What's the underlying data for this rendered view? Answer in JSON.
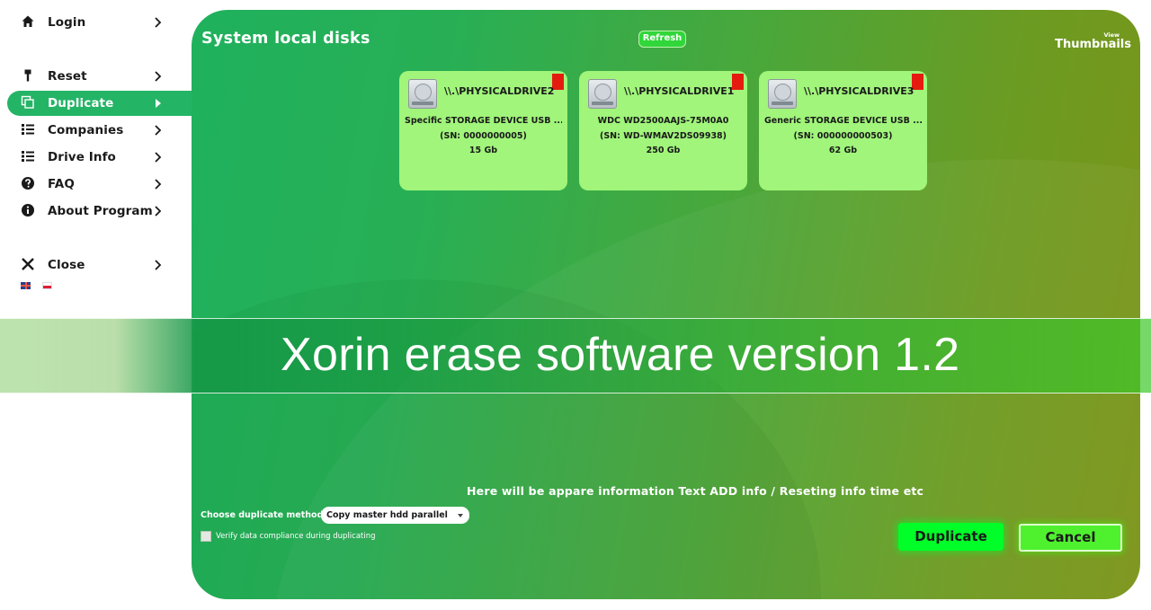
{
  "sidebar": {
    "items": [
      {
        "label": "Login",
        "icon": "home-icon"
      },
      {
        "label": "Reset",
        "icon": "tool-icon"
      },
      {
        "label": "Duplicate",
        "icon": "copy-icon",
        "active": true
      },
      {
        "label": "Companies",
        "icon": "list-icon"
      },
      {
        "label": "Drive Info",
        "icon": "list-icon"
      },
      {
        "label": "FAQ",
        "icon": "help-icon"
      },
      {
        "label": "About Program",
        "icon": "info-icon"
      },
      {
        "label": "Close",
        "icon": "close-icon"
      }
    ],
    "languages": [
      "en",
      "pl"
    ]
  },
  "main": {
    "title": "System local disks",
    "refresh_label": "Refresh",
    "view_label": "View",
    "view_mode": "Thumbnails",
    "disks": [
      {
        "name": "\\\\.\\PHYSICALDRIVE2",
        "model": "Specific STORAGE DEVICE USB ...",
        "serial": "(SN: 0000000005)",
        "size": "15 Gb"
      },
      {
        "name": "\\\\.\\PHYSICALDRIVE1",
        "model": "WDC WD2500AAJS-75M0A0",
        "serial": "(SN: WD-WMAV2DS09938)",
        "size": "250 Gb"
      },
      {
        "name": "\\\\.\\PHYSICALDRIVE3",
        "model": "Generic STORAGE DEVICE USB ...",
        "serial": "(SN: 000000000503)",
        "size": "62 Gb"
      }
    ],
    "info_text": "Here will be appare information Text ADD info / Reseting info time etc",
    "method_label": "Choose duplicate method",
    "method_value": "Copy master hdd parallel",
    "verify_label": "Verify data compliance during duplicating",
    "verify_checked": false,
    "duplicate_label": "Duplicate",
    "cancel_label": "Cancel"
  },
  "banner": {
    "text": "Xorin erase software version 1.2"
  },
  "colors": {
    "accent": "#24b466",
    "card": "#a0f57a",
    "duplicate_button": "#00ff28",
    "disk_flag": "#e51b10"
  }
}
